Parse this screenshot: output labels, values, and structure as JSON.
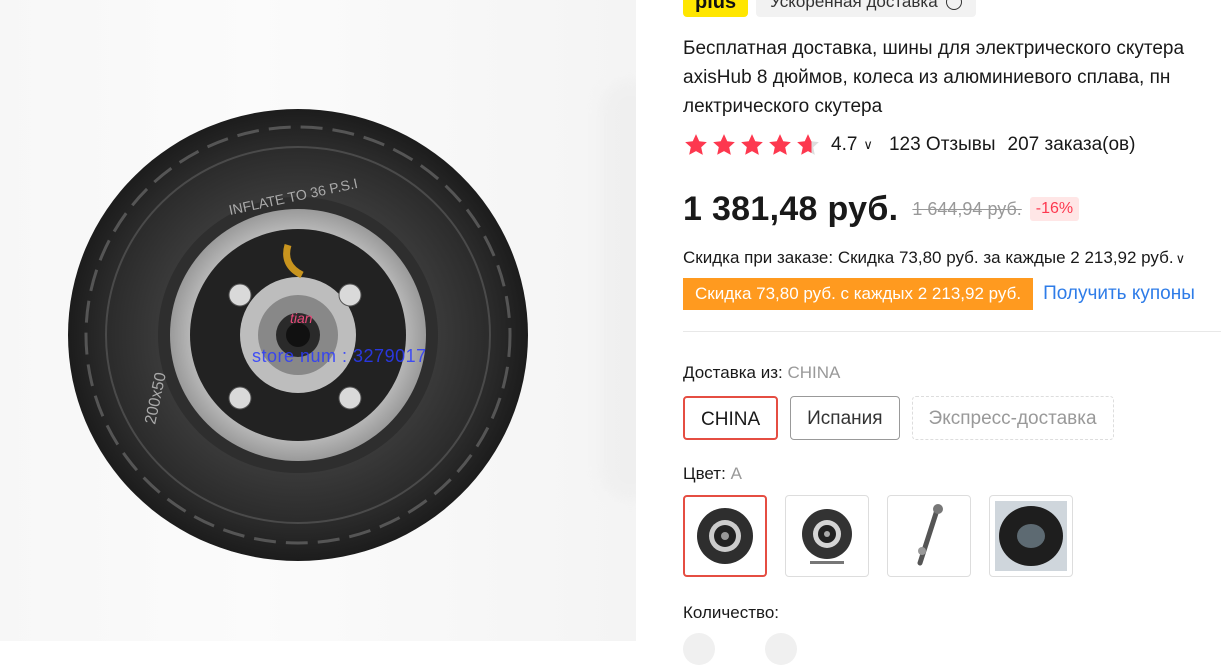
{
  "badges": {
    "plus_label": "plus",
    "shipping_label": "Ускоренная доставка"
  },
  "product": {
    "title_lines": [
      "Бесплатная доставка, шины для электрического скутера",
      "axisHub 8 дюймов, колеса из алюминиевого сплава, пн",
      "лектрического скутера"
    ],
    "rating_value": "4.7",
    "reviews": "123 Отзывы",
    "orders": "207 заказа(ов)",
    "price": "1 381,48 руб.",
    "old_price": "1 644,94 руб.",
    "discount": "-16%"
  },
  "promo": {
    "line": "Скидка при заказе: Скидка 73,80 руб. за каждые 2 213,92 руб.",
    "tag": "Скидка 73,80 руб. с каждых 2 213,92 руб.",
    "coupon_link": "Получить купоны"
  },
  "shipping": {
    "label": "Доставка из:",
    "selected": "CHINA",
    "options": [
      "CHINA",
      "Испания",
      "Экспресс-доставка"
    ]
  },
  "color": {
    "label": "Цвет:",
    "selected": "A"
  },
  "quantity": {
    "label": "Количество:"
  },
  "image_watermark": {
    "store_text": "store num : 3279017",
    "signature": "tian"
  },
  "colors": {
    "accent_red": "#e54d42",
    "promo_orange": "#ff9a1f",
    "link_blue": "#2e7ce8",
    "star_red": "#fd384f"
  }
}
